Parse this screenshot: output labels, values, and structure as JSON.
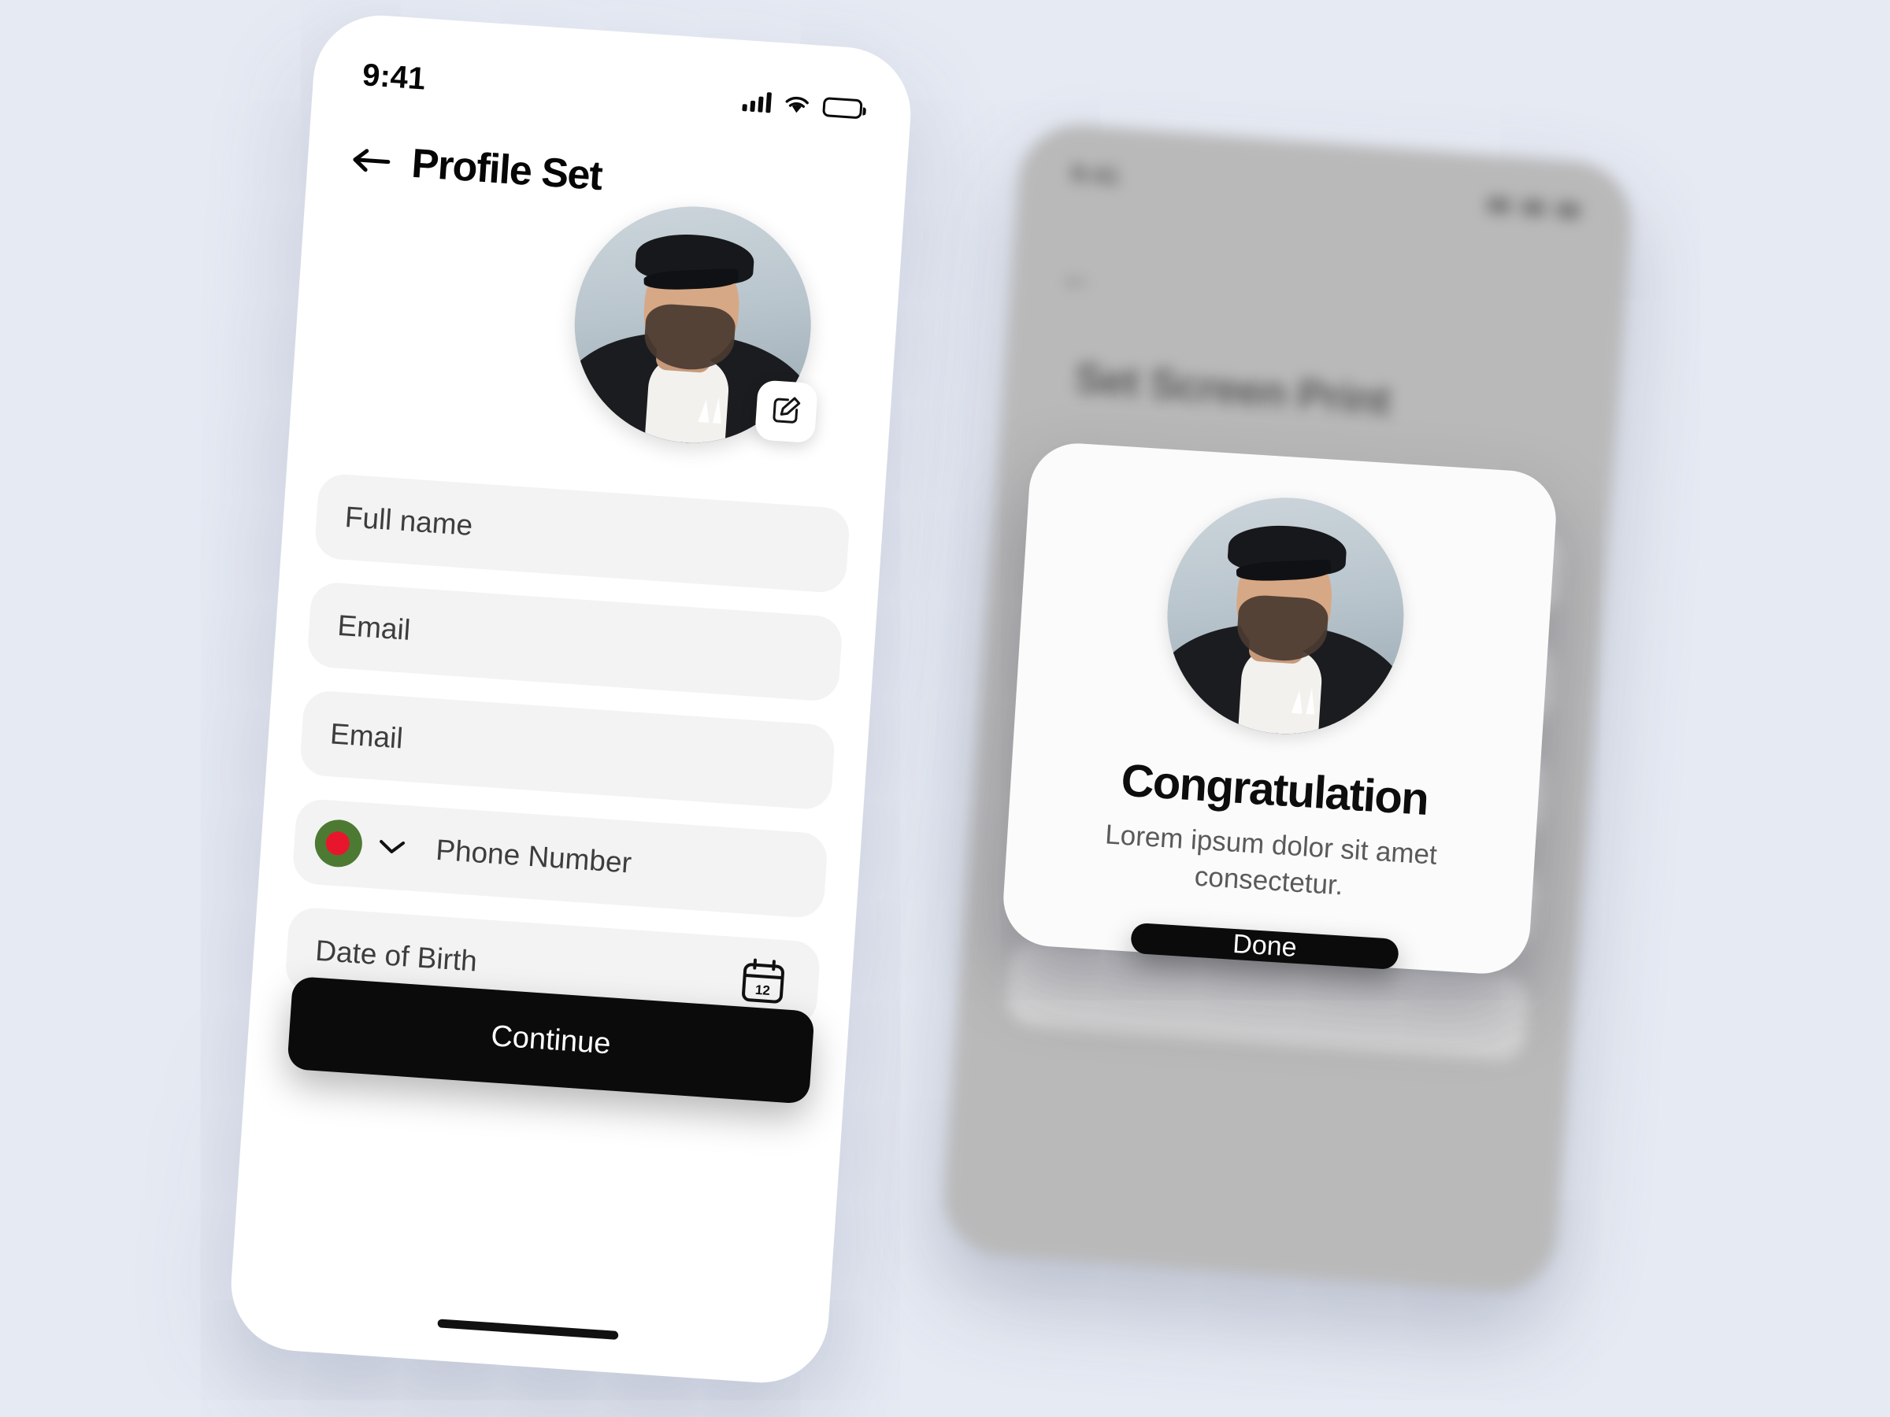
{
  "theme": {
    "page_background": "#e6eaf3",
    "phone_background": "#ffffff",
    "field_background": "#f3f3f3",
    "accent_dark": "#0b0b0b",
    "text_primary": "#060606",
    "text_secondary": "#5a5a5a",
    "flag_green": "#4d7a33",
    "flag_red": "#e8162c"
  },
  "front_phone": {
    "status_bar": {
      "time": "9:41",
      "icons": [
        "cellular-signal-icon",
        "wifi-icon",
        "battery-icon"
      ]
    },
    "header": {
      "back_icon": "back-arrow-icon",
      "title": "Profile Set"
    },
    "avatar": {
      "name": "profile-avatar",
      "edit_icon": "edit-pencil-icon"
    },
    "form": {
      "fields": [
        {
          "name": "full-name-field",
          "placeholder": "Full name",
          "icon": null
        },
        {
          "name": "email-field",
          "placeholder": "Email",
          "icon": null
        },
        {
          "name": "email-field-secondary",
          "placeholder": "Email",
          "icon": null
        },
        {
          "name": "phone-field",
          "placeholder": "Phone Number",
          "icon": "chevron-down-icon",
          "flag": "bangladesh-flag-icon"
        },
        {
          "name": "date-of-birth-field",
          "placeholder": "Date of Birth",
          "icon": "calendar-icon",
          "calendar_day": "12"
        }
      ]
    },
    "primary_button": {
      "label": "Continue"
    }
  },
  "back_phone": {
    "status_bar": {
      "time": "9:41"
    },
    "header": {
      "title": "Set Screen Print"
    },
    "blurred": true
  },
  "congrats_card": {
    "avatar": "profile-avatar",
    "title": "Congratulation",
    "subtitle": "Lorem ipsum dolor sit amet consectetur.",
    "button": {
      "label": "Done"
    }
  }
}
